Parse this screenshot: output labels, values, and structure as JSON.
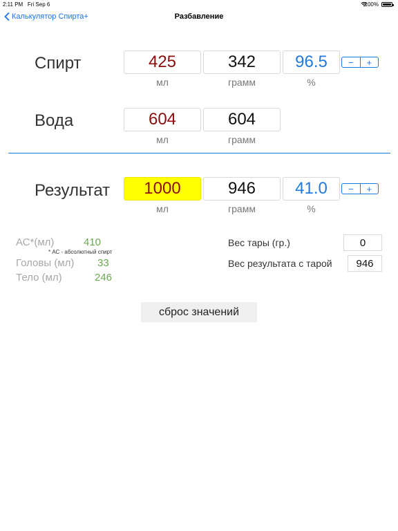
{
  "status": {
    "time": "2:11 PM",
    "date": "Fri Sep 6",
    "battery": "100%"
  },
  "nav": {
    "back": "Калькулятор Спирта+",
    "title": "Разбавление"
  },
  "alcohol": {
    "label": "Спирт",
    "ml": "425",
    "gram": "342",
    "percent": "96.5",
    "unit_ml": "мл",
    "unit_gram": "грамм",
    "unit_pct": "%"
  },
  "water": {
    "label": "Вода",
    "ml": "604",
    "gram": "604",
    "unit_ml": "мл",
    "unit_gram": "грамм"
  },
  "result": {
    "label": "Результат",
    "ml": "1000",
    "gram": "946",
    "percent": "41.0",
    "unit_ml": "мл",
    "unit_gram": "грамм",
    "unit_pct": "%"
  },
  "stepper": {
    "minus": "−",
    "plus": "+"
  },
  "info": {
    "as_label": "АС*(мл)",
    "as_value": "410",
    "as_note": "* АС - абсолютный спирт",
    "heads_label": "Головы (мл)",
    "heads_value": "33",
    "body_label": "Тело (мл)",
    "body_value": "246",
    "tare_label": "Вес тары (гр.)",
    "tare_value": "0",
    "result_weight_label": "Вес результата с тарой",
    "result_weight_value": "946"
  },
  "reset_label": "сброс значений",
  "colors": {
    "accent": "#1f7ae0",
    "red_value": "#8b0d0d",
    "highlight": "#ffff00",
    "green": "#6aa84f"
  },
  "icons": {
    "back": "chevron-left-icon",
    "wifi": "wifi-icon",
    "battery": "battery-icon"
  }
}
